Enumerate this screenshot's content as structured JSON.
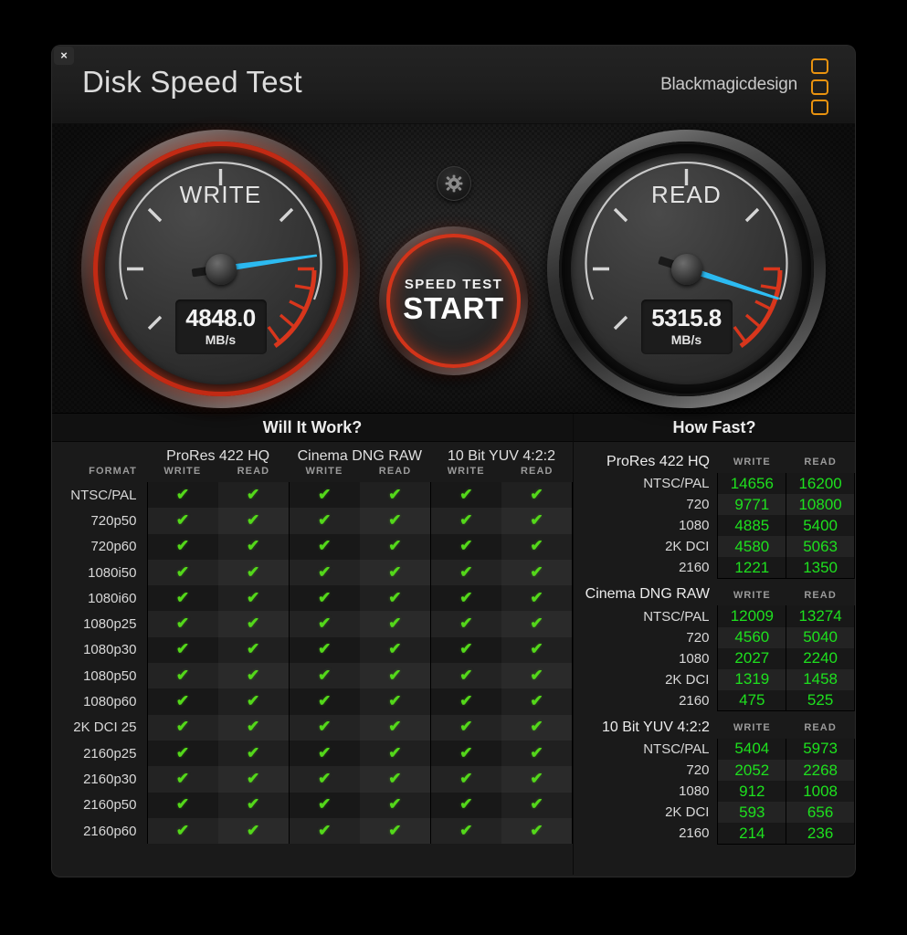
{
  "window": {
    "title": "Disk Speed Test",
    "close_label": "×",
    "brand": "Blackmagicdesign",
    "accent_orange": "#e8920f",
    "accent_red": "#d2341a",
    "accent_green": "#1ee01e",
    "needle_blue": "#2fc0f5"
  },
  "gauges": {
    "write": {
      "label": "WRITE",
      "value": "4848.0",
      "unit": "MB/s",
      "needle_angle_deg": -8
    },
    "read": {
      "label": "READ",
      "value": "5315.8",
      "unit": "MB/s",
      "needle_angle_deg": 18
    },
    "start_button": {
      "small_label": "SPEED TEST",
      "big_label": "START"
    },
    "settings_icon": "gear-icon"
  },
  "will_it_work": {
    "title": "Will It Work?",
    "format_header": "FORMAT",
    "groups": [
      {
        "name": "ProRes 422 HQ",
        "cols": [
          "WRITE",
          "READ"
        ]
      },
      {
        "name": "Cinema DNG RAW",
        "cols": [
          "WRITE",
          "READ"
        ]
      },
      {
        "name": "10 Bit YUV 4:2:2",
        "cols": [
          "WRITE",
          "READ"
        ]
      }
    ],
    "check_glyph": "✔",
    "rows": [
      {
        "format": "NTSC/PAL",
        "cells": [
          true,
          true,
          true,
          true,
          true,
          true
        ]
      },
      {
        "format": "720p50",
        "cells": [
          true,
          true,
          true,
          true,
          true,
          true
        ]
      },
      {
        "format": "720p60",
        "cells": [
          true,
          true,
          true,
          true,
          true,
          true
        ]
      },
      {
        "format": "1080i50",
        "cells": [
          true,
          true,
          true,
          true,
          true,
          true
        ]
      },
      {
        "format": "1080i60",
        "cells": [
          true,
          true,
          true,
          true,
          true,
          true
        ]
      },
      {
        "format": "1080p25",
        "cells": [
          true,
          true,
          true,
          true,
          true,
          true
        ]
      },
      {
        "format": "1080p30",
        "cells": [
          true,
          true,
          true,
          true,
          true,
          true
        ]
      },
      {
        "format": "1080p50",
        "cells": [
          true,
          true,
          true,
          true,
          true,
          true
        ]
      },
      {
        "format": "1080p60",
        "cells": [
          true,
          true,
          true,
          true,
          true,
          true
        ]
      },
      {
        "format": "2K DCI 25",
        "cells": [
          true,
          true,
          true,
          true,
          true,
          true
        ]
      },
      {
        "format": "2160p25",
        "cells": [
          true,
          true,
          true,
          true,
          true,
          true
        ]
      },
      {
        "format": "2160p30",
        "cells": [
          true,
          true,
          true,
          true,
          true,
          true
        ]
      },
      {
        "format": "2160p50",
        "cells": [
          true,
          true,
          true,
          true,
          true,
          true
        ]
      },
      {
        "format": "2160p60",
        "cells": [
          true,
          true,
          true,
          true,
          true,
          true
        ]
      }
    ]
  },
  "how_fast": {
    "title": "How Fast?",
    "col_write": "WRITE",
    "col_read": "READ",
    "sections": [
      {
        "name": "ProRes 422 HQ",
        "rows": [
          {
            "label": "NTSC/PAL",
            "write": "14656",
            "read": "16200"
          },
          {
            "label": "720",
            "write": "9771",
            "read": "10800"
          },
          {
            "label": "1080",
            "write": "4885",
            "read": "5400"
          },
          {
            "label": "2K DCI",
            "write": "4580",
            "read": "5063"
          },
          {
            "label": "2160",
            "write": "1221",
            "read": "1350"
          }
        ]
      },
      {
        "name": "Cinema DNG RAW",
        "rows": [
          {
            "label": "NTSC/PAL",
            "write": "12009",
            "read": "13274"
          },
          {
            "label": "720",
            "write": "4560",
            "read": "5040"
          },
          {
            "label": "1080",
            "write": "2027",
            "read": "2240"
          },
          {
            "label": "2K DCI",
            "write": "1319",
            "read": "1458"
          },
          {
            "label": "2160",
            "write": "475",
            "read": "525"
          }
        ]
      },
      {
        "name": "10 Bit YUV 4:2:2",
        "rows": [
          {
            "label": "NTSC/PAL",
            "write": "5404",
            "read": "5973"
          },
          {
            "label": "720",
            "write": "2052",
            "read": "2268"
          },
          {
            "label": "1080",
            "write": "912",
            "read": "1008"
          },
          {
            "label": "2K DCI",
            "write": "593",
            "read": "656"
          },
          {
            "label": "2160",
            "write": "214",
            "read": "236"
          }
        ]
      }
    ]
  }
}
